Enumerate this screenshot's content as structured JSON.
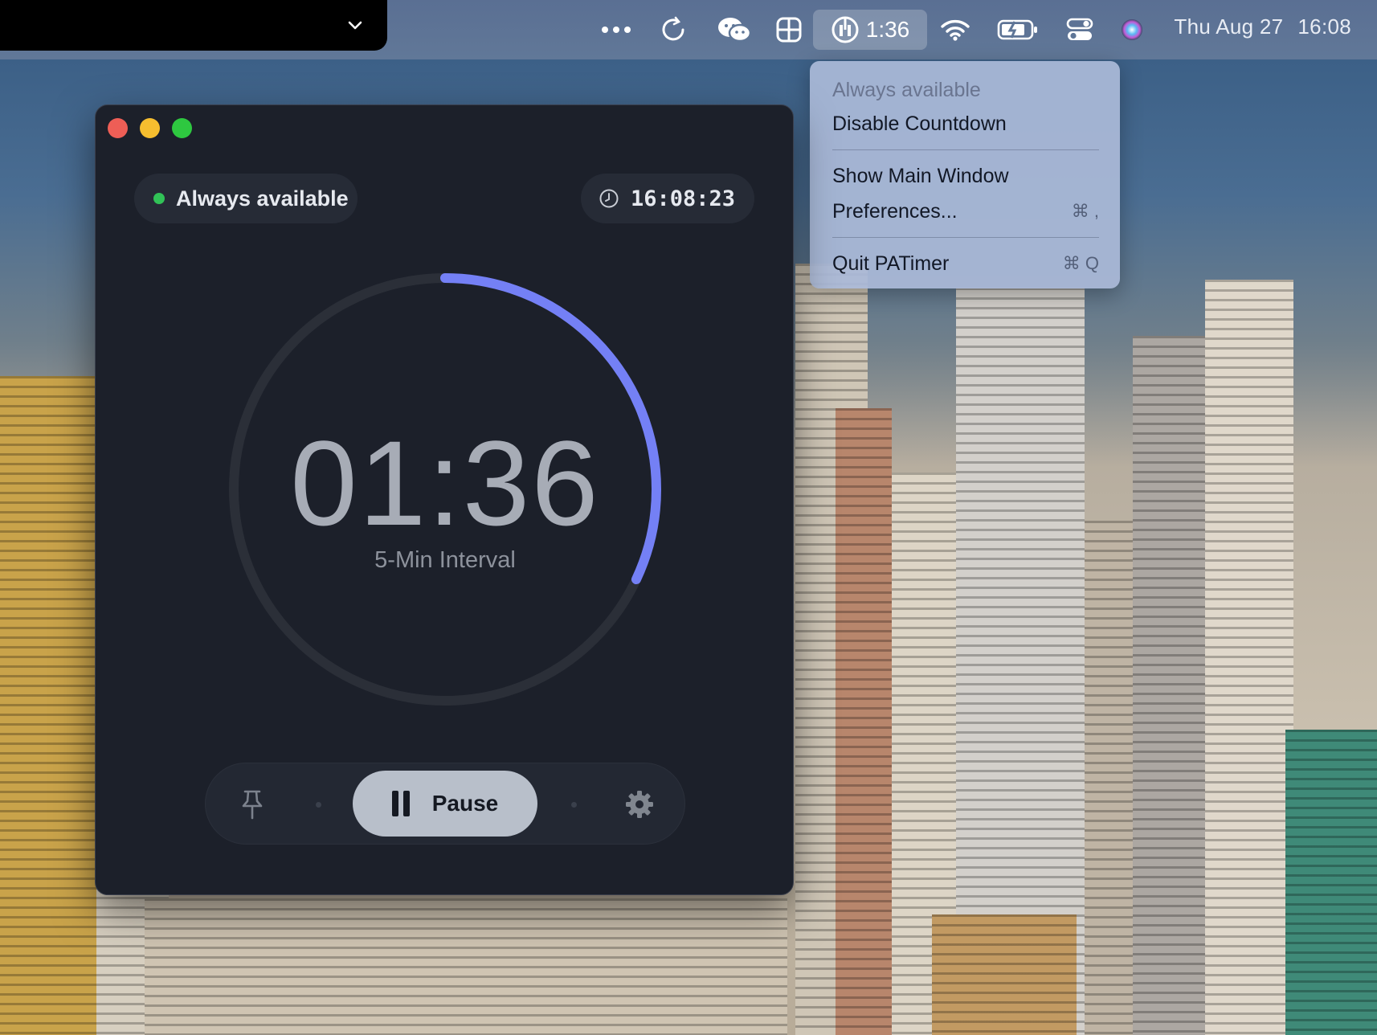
{
  "menubar": {
    "timer_label": "1:36",
    "clock_date": "Thu Aug 27",
    "clock_time": "16:08",
    "icons": [
      "chevron-down-icon",
      "more-icon",
      "sync-icon",
      "wechat-icon",
      "grid-icon",
      "timer-icon",
      "wifi-icon",
      "battery-icon",
      "control-center-icon",
      "siri-icon"
    ]
  },
  "dropdown": {
    "header": "Always available",
    "items": [
      {
        "label": "Disable Countdown",
        "shortcut": ""
      },
      {
        "label": "Show Main Window",
        "shortcut": ""
      },
      {
        "label": "Preferences...",
        "shortcut": "⌘ ,"
      },
      {
        "label": "Quit PATimer",
        "shortcut": "⌘ Q"
      }
    ]
  },
  "window": {
    "status_label": "Always available",
    "clock": "16:08:23",
    "countdown": "01:36",
    "interval_label": "5-Min Interval",
    "progress_remaining_fraction": 0.32,
    "pause_label": "Pause",
    "colors": {
      "accent": "#7480f5",
      "status_green": "#31c257",
      "background": "#1c202a"
    }
  }
}
